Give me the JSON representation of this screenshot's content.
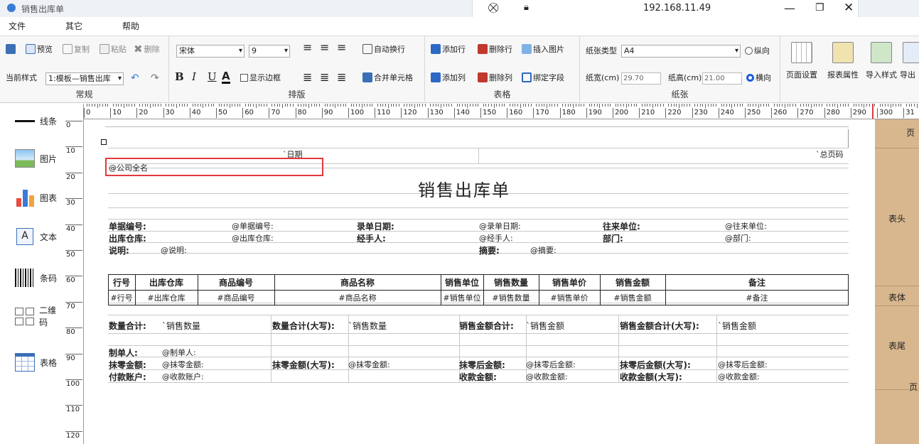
{
  "titlebar": {
    "app_title": "销售出库单",
    "address": "192.168.11.49"
  },
  "menu": [
    "文件",
    "其它",
    "帮助"
  ],
  "ribbon": {
    "groups": [
      "常规",
      "排版",
      "表格",
      "纸张"
    ],
    "preview": "预览",
    "copy": "复制",
    "paste": "粘贴",
    "delete": "删除",
    "current_style_label": "当前样式",
    "current_style_value": "1:模板—销售出库",
    "font_name": "宋体",
    "font_size": "9",
    "bold": "B",
    "italic": "I",
    "underline": "U",
    "font_color": "A",
    "show_border": "显示边框",
    "auto_wrap": "自动换行",
    "merge_cells": "合并单元格",
    "add_row": "添加行",
    "delete_row": "删除行",
    "insert_image": "插入图片",
    "add_col": "添加列",
    "delete_col": "删除列",
    "bind_field": "绑定字段",
    "paper_type_label": "纸张类型",
    "paper_type_value": "A4",
    "portrait": "纵向",
    "landscape": "横向",
    "paper_width_label": "纸宽(cm)",
    "paper_width_value": "29.70",
    "paper_height_label": "纸高(cm)",
    "paper_height_value": "21.00",
    "page_setup": "页面设置",
    "report_props": "报表属性",
    "import_style": "导入样式",
    "export": "导出"
  },
  "tools": [
    "线条",
    "图片",
    "图表",
    "文本",
    "条码",
    "二维码",
    "表格"
  ],
  "ruler": {
    "h": [
      "0",
      "10",
      "20",
      "30",
      "40",
      "50",
      "60",
      "70",
      "80",
      "90",
      "100",
      "110",
      "120",
      "130",
      "140",
      "150",
      "160",
      "170",
      "180",
      "190",
      "200",
      "210",
      "220",
      "230",
      "240",
      "250",
      "260",
      "270",
      "280",
      "290",
      "300",
      "31"
    ],
    "v": [
      "0",
      "10",
      "20",
      "30",
      "40",
      "50",
      "60",
      "70",
      "80",
      "90",
      "100",
      "110",
      "120"
    ]
  },
  "sidebar": {
    "top_cut": "页",
    "header": "表头",
    "body": "表体",
    "footer": "表尾",
    "bottom_cut": "页"
  },
  "report": {
    "date": "`日期",
    "total_pages": "`总页码",
    "company": "@公司全名",
    "title": "销售出库单",
    "info": [
      [
        "单据编号:",
        "@单据编号:",
        "录单日期:",
        "@录单日期:",
        "往来单位:",
        "@往来单位:"
      ],
      [
        "出库仓库:",
        "@出库仓库:",
        "经手人:",
        "@经手人:",
        "部门:",
        "@部门:"
      ]
    ],
    "desc_label": "说明:",
    "desc_val": "@说明:",
    "summary_label": "摘要:",
    "summary_val": "@摘要:",
    "table_headers": [
      "行号",
      "出库仓库",
      "商品编号",
      "商品名称",
      "销售单位",
      "销售数量",
      "销售单价",
      "销售金额",
      "备注"
    ],
    "table_cells": [
      "#行号",
      "#出库仓库",
      "#商品编号",
      "#商品名称",
      "#销售单位",
      "#销售数量",
      "#销售单价",
      "#销售金额",
      "#备注"
    ],
    "totals": [
      "数量合计:",
      "`销售数量",
      "数量合计(大写):",
      "`销售数量",
      "销售金额合计:",
      "`销售金额",
      "销售金额合计(大写):",
      "`销售金额"
    ],
    "maker_label": "制单人:",
    "maker_val": "@制单人:",
    "round_row": [
      "抹零金额:",
      "@抹零金额:",
      "抹零金额(大写):",
      "@抹零金额:",
      "抹零后金额:",
      "@抹零后金额:",
      "抹零后金额(大写):",
      "@抹零后金额:"
    ],
    "pay_row": [
      "付款账户:",
      "@收款账户:",
      "收款金额:",
      "@收款金额:",
      "收款金额(大写):",
      "@收款金额:"
    ]
  },
  "colors": {
    "highlight": "#e0393e",
    "sidebar": "#d9b78e",
    "accent": "#1a5ed8"
  }
}
